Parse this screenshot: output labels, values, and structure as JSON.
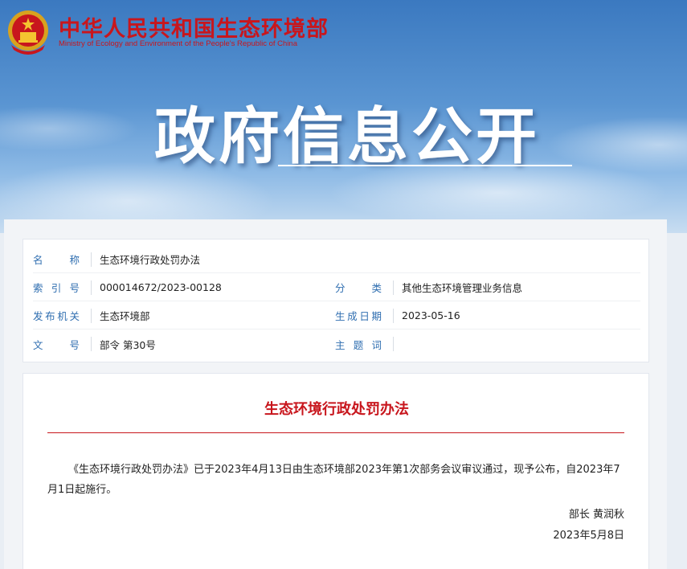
{
  "header": {
    "site_title": "中华人民共和国生态环境部",
    "site_subtitle": "Ministry of Ecology and Environment of the People's Republic of China",
    "logo_icon": "national-emblem-icon",
    "hero_title": "政府信息公开"
  },
  "info": {
    "name_label": "名 称",
    "name_value": "生态环境行政处罚办法",
    "index_label": "索 引 号",
    "index_value": "000014672/2023-00128",
    "category_label": "分 类",
    "category_value": "其他生态环境管理业务信息",
    "issuer_label": "发布机关",
    "issuer_value": "生态环境部",
    "date_label": "生成日期",
    "date_value": "2023-05-16",
    "docno_label": "文 号",
    "docno_value": "部令 第30号",
    "keywords_label": "主 题 词",
    "keywords_value": ""
  },
  "document": {
    "title": "生态环境行政处罚办法",
    "body": "《生态环境行政处罚办法》已于2023年4月13日由生态环境部2023年第1次部务会议审议通过，现予公布，自2023年7月1日起施行。",
    "signer": "部长 黄润秋",
    "sign_date": "2023年5月8日"
  },
  "colors": {
    "brand_red": "#c8161d",
    "label_blue": "#2f6eb0"
  }
}
